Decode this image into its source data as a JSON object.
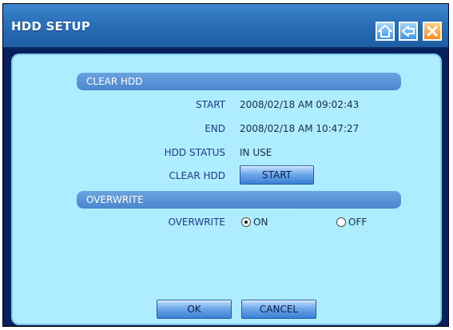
{
  "window": {
    "title": "HDD SETUP"
  },
  "titlebar_buttons": {
    "home": "home-icon",
    "back": "back-arrow-icon",
    "close": "close-icon"
  },
  "clear_hdd": {
    "section_title": "CLEAR HDD",
    "start_label": "START",
    "start_value": "2008/02/18 AM 09:02:43",
    "end_label": "END",
    "end_value": "2008/02/18 AM 10:47:27",
    "status_label": "HDD STATUS",
    "status_value": "IN USE",
    "clear_label": "CLEAR HDD",
    "clear_button": "START"
  },
  "overwrite": {
    "section_title": "OVERWRITE",
    "label": "OVERWRITE",
    "option_on": "ON",
    "option_off": "OFF",
    "selected": "ON"
  },
  "footer": {
    "ok": "OK",
    "cancel": "CANCEL"
  },
  "colors": {
    "panel": "#aeecff",
    "titlebar": "#2a6fb8",
    "section": "#5a93d8",
    "window_frame": "#08215c"
  }
}
